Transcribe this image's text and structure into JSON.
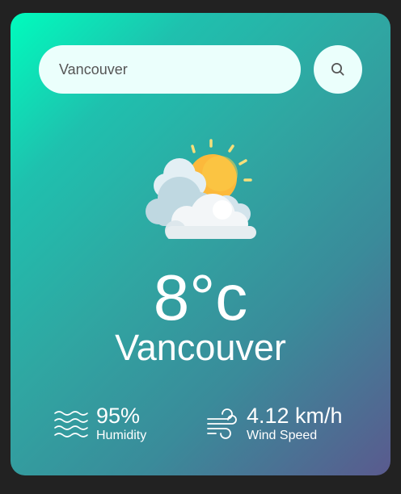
{
  "search": {
    "value": "Vancouver",
    "button_icon": "search-icon"
  },
  "weather": {
    "icon": "partly-cloudy-icon",
    "temperature": "8°c",
    "city": "Vancouver"
  },
  "details": {
    "humidity": {
      "icon": "humidity-icon",
      "value": "95%",
      "label": "Humidity"
    },
    "wind": {
      "icon": "wind-icon",
      "value": "4.12 km/h",
      "label": "Wind Speed"
    }
  },
  "colors": {
    "page_background": "#222222",
    "gradient_start": "#00fcbd",
    "gradient_end": "#5a5a8e",
    "input_background": "#ebfffc"
  }
}
